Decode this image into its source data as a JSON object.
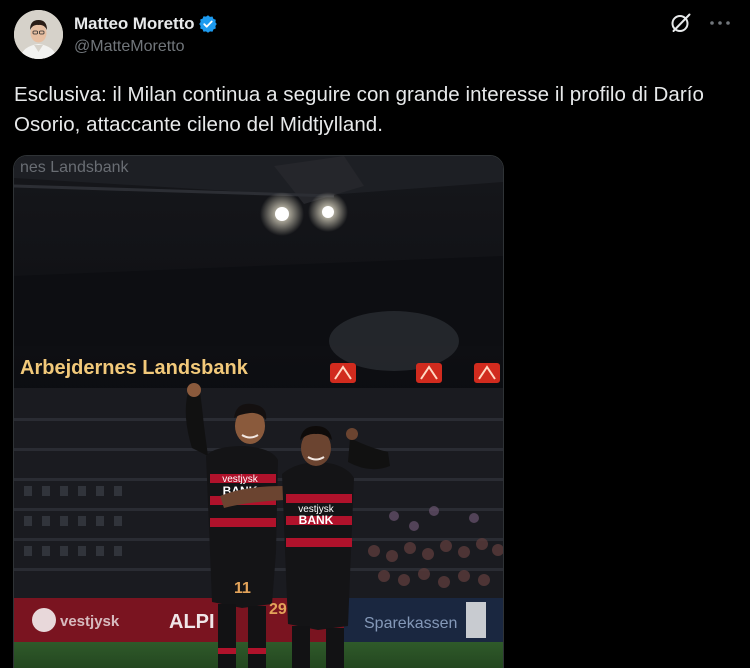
{
  "author": {
    "display_name": "Matteo Moretto",
    "handle": "@MatteMoretto",
    "verified": true
  },
  "tweet": {
    "text": "Esclusiva: il Milan continua a seguire con grande interesse il profilo di Darío Osorio, attaccante cileno del Midtjylland."
  },
  "media": {
    "stadium_signs": [
      "Arbejdernes Landsbank",
      "nes Landsbank",
      "ALPI"
    ],
    "player_left_number": "11",
    "player_right_number": "29",
    "shirt_sponsor_line1": "vestjysk",
    "shirt_sponsor_line2": "BANK"
  },
  "icons": {
    "grok": "grok-icon",
    "more": "more-icon",
    "verified": "verified-badge-icon"
  },
  "colors": {
    "background": "#000000",
    "text_primary": "#e7e9ea",
    "text_secondary": "#71767b",
    "verified_blue": "#1d9bf0",
    "kit_red": "#b0122b"
  }
}
